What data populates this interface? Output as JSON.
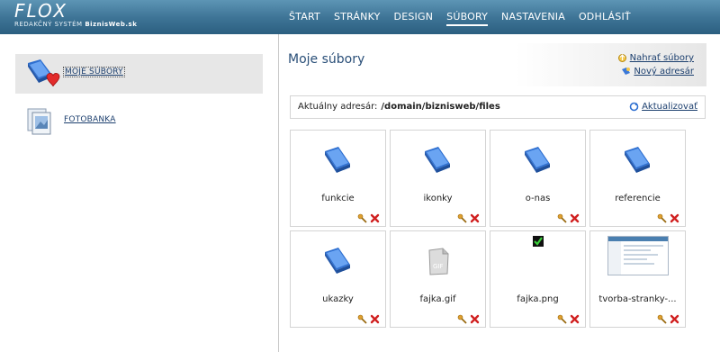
{
  "header": {
    "logo_name": "FLOX",
    "logo_sub": "REDAKČNÝ SYSTÉM",
    "logo_brand": "BiznisWeb.sk",
    "nav": [
      {
        "label": "ŠTART",
        "active": false
      },
      {
        "label": "STRÁNKY",
        "active": false
      },
      {
        "label": "DESIGN",
        "active": false
      },
      {
        "label": "SÚBORY",
        "active": true
      },
      {
        "label": "NASTAVENIA",
        "active": false
      },
      {
        "label": "ODHLÁSIŤ",
        "active": false
      }
    ]
  },
  "sidebar": {
    "items": [
      {
        "label": "MOJE SÚBORY",
        "icon": "my-files-icon",
        "active": true
      },
      {
        "label": "FOTOBANKA",
        "icon": "photobank-icon",
        "active": false
      }
    ]
  },
  "main": {
    "title": "Moje súbory",
    "upload_label": "Nahrať súbory",
    "new_dir_label": "Nový adresár",
    "dir_label": "Aktuálny adresár:",
    "dir_path": "/domain/biznisweb/files",
    "refresh_label": "Aktualizovať"
  },
  "files": [
    {
      "name": "funkcie",
      "type": "folder"
    },
    {
      "name": "ikonky",
      "type": "folder"
    },
    {
      "name": "o-nas",
      "type": "folder"
    },
    {
      "name": "referencie",
      "type": "folder"
    },
    {
      "name": "ukazky",
      "type": "folder"
    },
    {
      "name": "fajka.gif",
      "type": "gif"
    },
    {
      "name": "fajka.png",
      "type": "png"
    },
    {
      "name": "tvorba-stranky-...",
      "type": "image"
    }
  ],
  "colors": {
    "header": "#3f7597",
    "link": "#1c3f6e",
    "folder": "#3a78d8",
    "delete": "#d02020"
  }
}
